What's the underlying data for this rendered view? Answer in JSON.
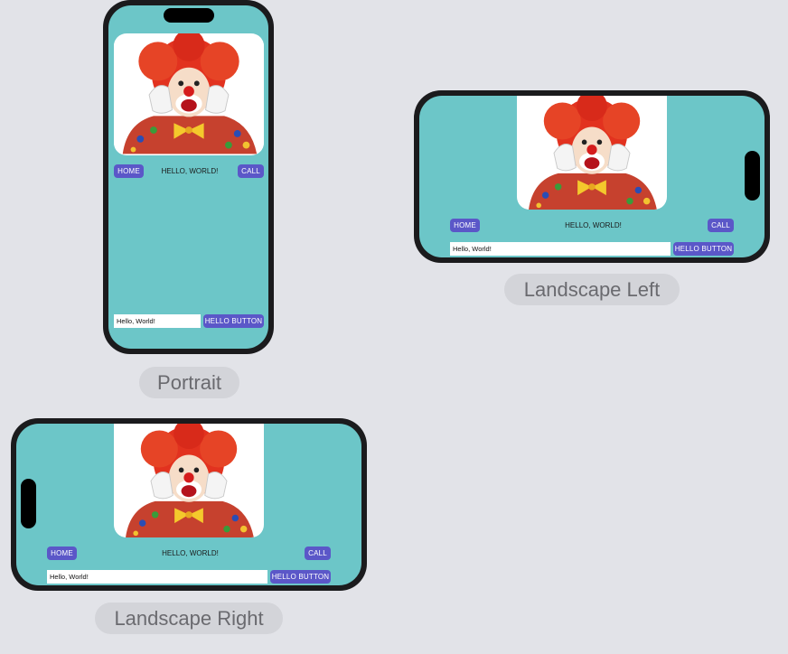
{
  "devices": {
    "portrait": {
      "caption": "Portrait",
      "home_label": "HOME",
      "title": "HELLO, WORLD!",
      "call_label": "CALL",
      "text_value": "Hello, World!",
      "hello_button_label": "HELLO BUTTON"
    },
    "landscape_left": {
      "caption": "Landscape Left",
      "home_label": "HOME",
      "title": "HELLO, WORLD!",
      "call_label": "CALL",
      "text_value": "Hello, World!",
      "hello_button_label": "HELLO BUTTON"
    },
    "landscape_right": {
      "caption": "Landscape Right",
      "home_label": "HOME",
      "title": "HELLO, WORLD!",
      "call_label": "CALL",
      "text_value": "Hello, World!",
      "hello_button_label": "HELLO BUTTON"
    }
  },
  "icons": {
    "clown_image": "clown-image"
  },
  "colors": {
    "screen": "#6cc6c8",
    "button": "#5b57c8",
    "frame": "#1b1b1d",
    "canvas": "#e2e3e8"
  }
}
